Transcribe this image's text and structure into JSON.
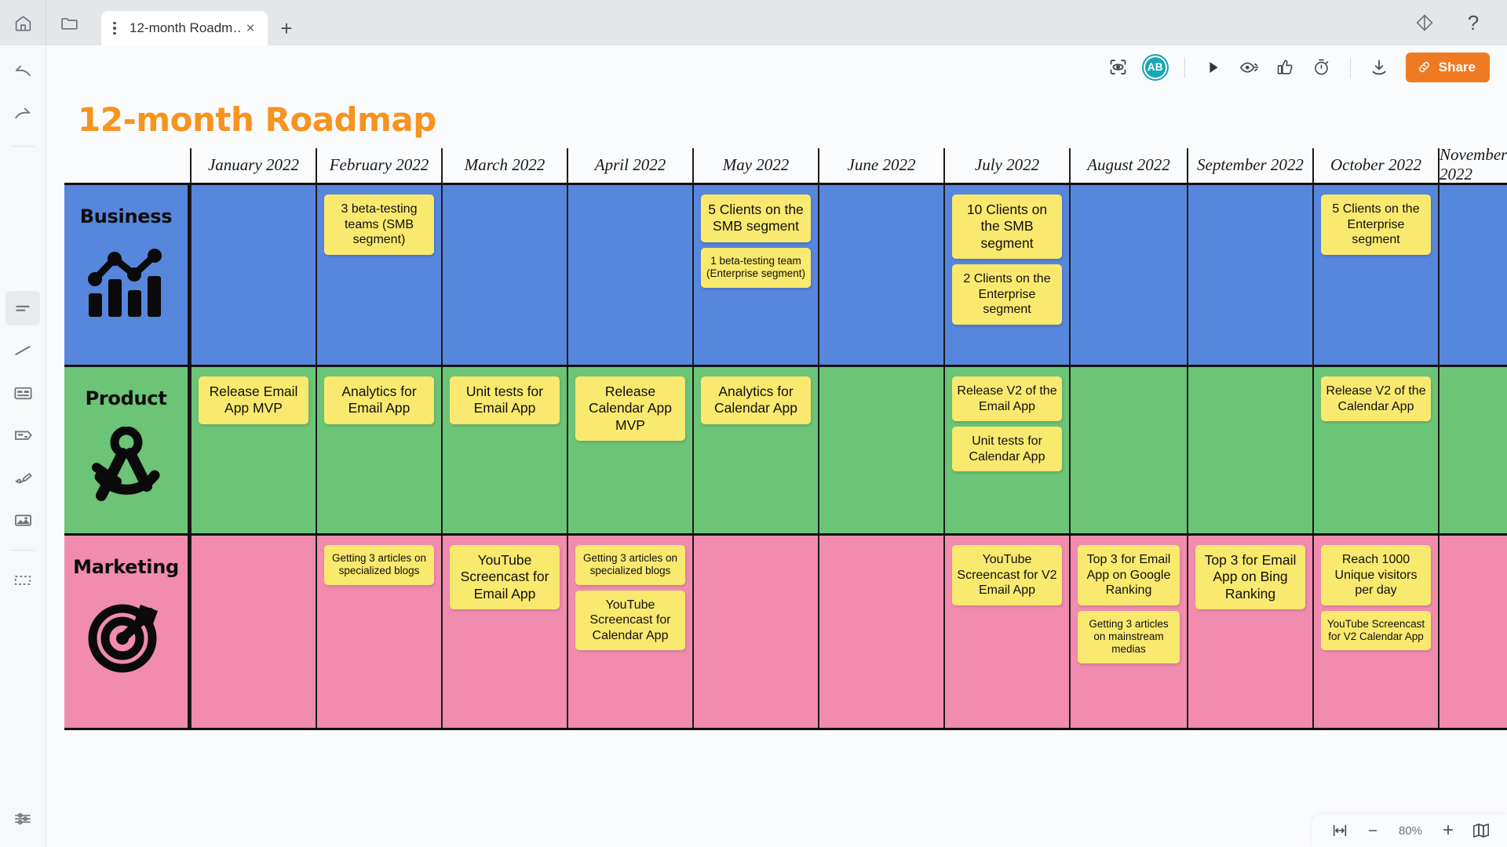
{
  "tabbar": {
    "home_icon": "home-icon",
    "folder_icon": "folder-icon",
    "tab_title": "12-month Roadm…",
    "close_label": "×",
    "new_tab_label": "+",
    "diamond_icon": "diamond-icon",
    "help_label": "?"
  },
  "toolbar": {
    "focus_icon": "focus-frame-icon",
    "avatar_initials": "AB",
    "avatar_color": "#1aa7b5",
    "present_icon": "play-cursor-icon",
    "visibility_icon": "eye-motion-icon",
    "reactions_icon": "thumbs-up-icon",
    "timer_icon": "stopwatch-icon",
    "download_icon": "download-icon",
    "share_label": "Share",
    "share_color": "#f07a22"
  },
  "rail": {
    "items": [
      {
        "name": "undo-icon"
      },
      {
        "name": "redo-icon"
      },
      {
        "name": "text-tool-icon"
      },
      {
        "name": "line-tool-icon"
      },
      {
        "name": "card-tool-icon"
      },
      {
        "name": "sticky-note-tool-icon"
      },
      {
        "name": "pen-tool-icon"
      },
      {
        "name": "image-tool-icon"
      },
      {
        "name": "frame-tool-icon"
      },
      {
        "name": "settings-sliders-icon"
      }
    ]
  },
  "board": {
    "title": "12-month Roadmap",
    "title_color": "#f7931e",
    "months": [
      "January 2022",
      "February 2022",
      "March 2022",
      "April 2022",
      "May 2022",
      "June 2022",
      "July 2022",
      "August 2022",
      "September 2022",
      "October 2022",
      "November 2022"
    ],
    "rows": [
      {
        "label": "Business",
        "color": "#5786dd",
        "icon": "bar-chart-icon",
        "cells": [
          [],
          [
            {
              "text": "3 beta-testing teams (SMB segment)",
              "size": "md"
            }
          ],
          [],
          [],
          [
            {
              "text": "5 Clients on the SMB segment",
              "size": "lg"
            },
            {
              "text": "1 beta-testing team (Enterprise segment)",
              "size": "sm"
            }
          ],
          [],
          [
            {
              "text": "10 Clients on the SMB segment",
              "size": "lg"
            },
            {
              "text": "2 Clients on the Enterprise segment",
              "size": "md"
            }
          ],
          [],
          [],
          [
            {
              "text": "5 Clients on the Enterprise segment",
              "size": "md"
            }
          ],
          []
        ]
      },
      {
        "label": "Product",
        "color": "#6cc477",
        "icon": "compass-icon",
        "cells": [
          [
            {
              "text": "Release Email App MVP",
              "size": "lg"
            }
          ],
          [
            {
              "text": "Analytics for Email App",
              "size": "lg"
            }
          ],
          [
            {
              "text": "Unit tests for Email App",
              "size": "lg"
            }
          ],
          [
            {
              "text": "Release Calendar App MVP",
              "size": "lg"
            }
          ],
          [
            {
              "text": "Analytics for Calendar App",
              "size": "lg"
            }
          ],
          [],
          [
            {
              "text": "Release V2 of the Email App",
              "size": "md"
            },
            {
              "text": "Unit tests for Calendar App",
              "size": "md"
            }
          ],
          [],
          [],
          [
            {
              "text": "Release V2 of the Calendar App",
              "size": "md"
            }
          ],
          []
        ]
      },
      {
        "label": "Marketing",
        "color": "#f18cae",
        "icon": "target-icon",
        "cells": [
          [],
          [
            {
              "text": "Getting 3 articles on specialized blogs",
              "size": "sm"
            }
          ],
          [
            {
              "text": "YouTube Screencast for Email App",
              "size": "lg"
            }
          ],
          [
            {
              "text": "Getting 3 articles on specialized blogs",
              "size": "sm"
            },
            {
              "text": "YouTube Screencast for Calendar App",
              "size": "md"
            }
          ],
          [],
          [],
          [
            {
              "text": "YouTube Screencast for V2 Email App",
              "size": "md"
            }
          ],
          [
            {
              "text": "Top 3 for Email App on Google Ranking",
              "size": "md"
            },
            {
              "text": "Getting 3 articles on mainstream medias",
              "size": "sm"
            }
          ],
          [
            {
              "text": "Top 3 for Email App on Bing Ranking",
              "size": "lg"
            }
          ],
          [
            {
              "text": "Reach 1000 Unique visitors per day",
              "size": "md"
            },
            {
              "text": "YouTube Screencast for V2 Calendar App",
              "size": "sm"
            }
          ],
          []
        ]
      }
    ],
    "note_color": "#fae96f"
  },
  "zoombar": {
    "fit_icon": "fit-width-icon",
    "minus_label": "−",
    "zoom_level": "80%",
    "plus_label": "+",
    "map_icon": "minimap-icon"
  }
}
